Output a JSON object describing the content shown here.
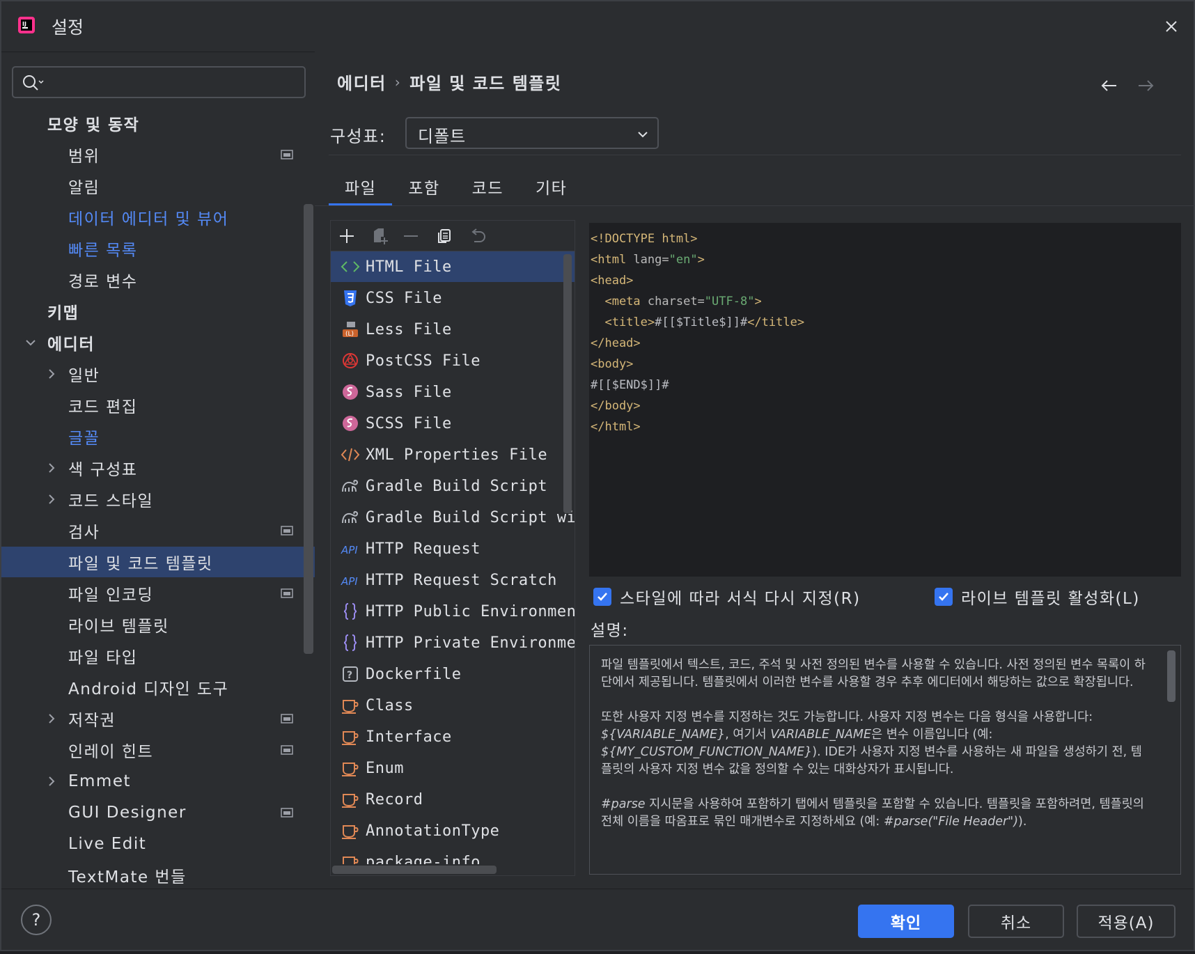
{
  "window": {
    "title": "설정"
  },
  "search": {
    "placeholder": ""
  },
  "nav": {
    "items": [
      {
        "label": "모양 및 동작",
        "level": 0,
        "bold": true,
        "expand": "none"
      },
      {
        "label": "범위",
        "level": 1,
        "project_icon": true
      },
      {
        "label": "알림",
        "level": 1
      },
      {
        "label": "데이터 에디터 및 뷰어",
        "level": 1,
        "link": true
      },
      {
        "label": "빠른 목록",
        "level": 1,
        "link": true
      },
      {
        "label": "경로 변수",
        "level": 1
      },
      {
        "label": "키맵",
        "level": 0,
        "bold": true
      },
      {
        "label": "에디터",
        "level": 0,
        "bold": true,
        "expand": "expanded"
      },
      {
        "label": "일반",
        "level": 1,
        "expand": "collapsed"
      },
      {
        "label": "코드 편집",
        "level": 1
      },
      {
        "label": "글꼴",
        "level": 1,
        "link": true
      },
      {
        "label": "색 구성표",
        "level": 1,
        "expand": "collapsed"
      },
      {
        "label": "코드 스타일",
        "level": 1,
        "expand": "collapsed"
      },
      {
        "label": "검사",
        "level": 1,
        "project_icon": true
      },
      {
        "label": "파일 및 코드 템플릿",
        "level": 1,
        "selected": true
      },
      {
        "label": "파일 인코딩",
        "level": 1,
        "project_icon": true
      },
      {
        "label": "라이브 템플릿",
        "level": 1
      },
      {
        "label": "파일 타입",
        "level": 1
      },
      {
        "label": "Android 디자인 도구",
        "level": 1
      },
      {
        "label": "저작권",
        "level": 1,
        "expand": "collapsed",
        "project_icon": true
      },
      {
        "label": "인레이 힌트",
        "level": 1,
        "project_icon": true
      },
      {
        "label": "Emmet",
        "level": 1,
        "expand": "collapsed"
      },
      {
        "label": "GUI Designer",
        "level": 1,
        "project_icon": true
      },
      {
        "label": "Live Edit",
        "level": 1
      },
      {
        "label": "TextMate 번들",
        "level": 1
      }
    ]
  },
  "breadcrumb": {
    "parent": "에디터",
    "separator": "›",
    "current": "파일 및 코드 템플릿"
  },
  "scheme": {
    "label": "구성표:",
    "value": "디폴트"
  },
  "tabs": [
    {
      "label": "파일",
      "active": true
    },
    {
      "label": "포함"
    },
    {
      "label": "코드"
    },
    {
      "label": "기타"
    }
  ],
  "templates": [
    {
      "name": "HTML File",
      "icon": "html-icon",
      "selected": true
    },
    {
      "name": "CSS File",
      "icon": "css-icon"
    },
    {
      "name": "Less File",
      "icon": "less-icon"
    },
    {
      "name": "PostCSS File",
      "icon": "postcss-icon"
    },
    {
      "name": "Sass File",
      "icon": "sass-icon"
    },
    {
      "name": "SCSS File",
      "icon": "scss-icon"
    },
    {
      "name": "XML Properties File",
      "icon": "xml-icon"
    },
    {
      "name": "Gradle Build Script",
      "icon": "gradle-icon"
    },
    {
      "name": "Gradle Build Script with",
      "icon": "gradle-icon"
    },
    {
      "name": "HTTP Request",
      "icon": "api-icon"
    },
    {
      "name": "HTTP Request Scratch",
      "icon": "api-icon"
    },
    {
      "name": "HTTP Public Environment F",
      "icon": "json-icon"
    },
    {
      "name": "HTTP Private Environment",
      "icon": "json-icon"
    },
    {
      "name": "Dockerfile",
      "icon": "unknown-file-icon"
    },
    {
      "name": "Class",
      "icon": "java-icon"
    },
    {
      "name": "Interface",
      "icon": "java-icon"
    },
    {
      "name": "Enum",
      "icon": "java-icon"
    },
    {
      "name": "Record",
      "icon": "java-icon"
    },
    {
      "name": "AnnotationType",
      "icon": "java-icon"
    },
    {
      "name": "package-info",
      "icon": "java-icon"
    }
  ],
  "editor": {
    "lines": [
      [
        [
          "tag",
          "<!DOCTYPE html>"
        ]
      ],
      [
        [
          "tag",
          "<html "
        ],
        [
          "attr",
          "lang="
        ],
        [
          "val",
          "\"en\""
        ],
        [
          "tag",
          ">"
        ]
      ],
      [
        [
          "tag",
          "<head>"
        ]
      ],
      [
        [
          "plain",
          "  "
        ],
        [
          "tag",
          "<meta "
        ],
        [
          "attr",
          "charset="
        ],
        [
          "val",
          "\"UTF-8\""
        ],
        [
          "tag",
          ">"
        ]
      ],
      [
        [
          "plain",
          "  "
        ],
        [
          "tag",
          "<title>"
        ],
        [
          "plain",
          "#[[$Title$]]#"
        ],
        [
          "tag",
          "</title>"
        ]
      ],
      [
        [
          "tag",
          "</head>"
        ]
      ],
      [
        [
          "tag",
          "<body>"
        ]
      ],
      [
        [
          "plain",
          "#[[$END$]]#"
        ]
      ],
      [
        [
          "tag",
          "</body>"
        ]
      ],
      [
        [
          "tag",
          "</html>"
        ]
      ]
    ]
  },
  "options": {
    "reformat_label": "스타일에 따라 서식 다시 지정(R)",
    "reformat_checked": true,
    "live_templates_label": "라이브 템플릿 활성화(L)",
    "live_templates_checked": true
  },
  "description": {
    "label": "설명:",
    "paragraphs": [
      [
        [
          "t",
          "파일 템플릿에서 텍스트, 코드, 주석 및 사전 정의된 변수를 사용할 수 있습니다. 사전 정의된 변수 목록이 하단에서 제공됩니다. 템플릿에서 이러한 변수를 사용할 경우 추후 에디터에서 해당하는 값으로 확장됩니다."
        ]
      ],
      [
        [
          "t",
          "또한 사용자 지정 변수를 지정하는 것도 가능합니다. 사용자 지정 변수는 다음 형식을 사용합니다: "
        ],
        [
          "i",
          "${VARIABLE_NAME}"
        ],
        [
          "t",
          ", 여기서 "
        ],
        [
          "i",
          "VARIABLE_NAME"
        ],
        [
          "t",
          "은 변수 이름입니다 (예: "
        ],
        [
          "i",
          "${MY_CUSTOM_FUNCTION_NAME}"
        ],
        [
          "t",
          "). IDE가 사용자 지정 변수를 사용하는 새 파일을 생성하기 전, 템플릿의 사용자 지정 변수 값을 정의할 수 있는 대화상자가 표시됩니다."
        ]
      ],
      [
        [
          "i",
          "#parse"
        ],
        [
          "t",
          " 지시문을 사용하여 포함하기 탭에서 템플릿을 포함할 수 있습니다. 템플릿을 포함하려면, 템플릿의 전체 이름을 따옴표로 묶인 매개변수로 지정하세요 (예: "
        ],
        [
          "i",
          "#parse(\"File Header\")"
        ],
        [
          "t",
          ")."
        ]
      ]
    ]
  },
  "footer": {
    "ok": "확인",
    "cancel": "취소",
    "apply": "적용(A)",
    "help": "?"
  },
  "colors": {
    "accent": "#3574f0",
    "selection": "#2e436e",
    "link": "#548af7"
  }
}
